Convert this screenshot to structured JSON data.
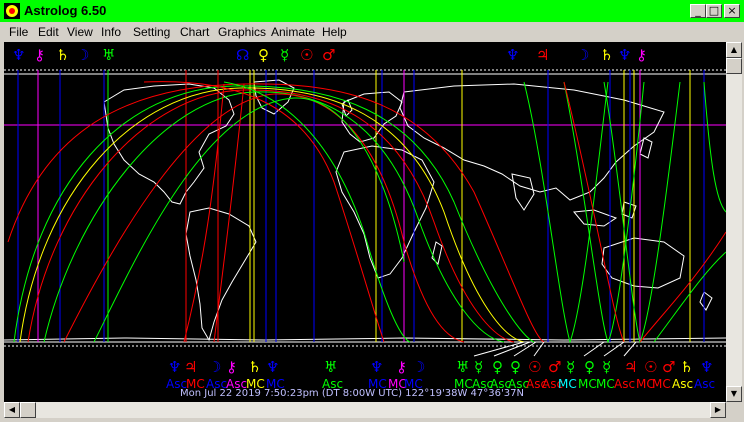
{
  "window": {
    "title": "Astrolog 6.50",
    "minimize": "_",
    "maximize": "□",
    "close": "×",
    "accent": "#00ff00"
  },
  "menu": [
    {
      "label": "File"
    },
    {
      "label": "Edit"
    },
    {
      "label": "View"
    },
    {
      "label": "Info"
    },
    {
      "label": "Setting"
    },
    {
      "label": "Chart"
    },
    {
      "label": "Graphics"
    },
    {
      "label": "Animate"
    },
    {
      "label": "Help"
    }
  ],
  "chart": {
    "status_text": "Mon Jul 22 2019  7:50:23pm (DT 8:00W UTC) 122°19'38W 47°36'37N",
    "top_glyphs": [
      {
        "glyph": "♆",
        "color": "#0000ff"
      },
      {
        "glyph": "⚷",
        "color": "#ff00ff"
      },
      {
        "glyph": "♄",
        "color": "#ffff00"
      },
      {
        "glyph": "☽",
        "color": "#0000ff"
      },
      {
        "glyph": "♅",
        "color": "#00ff00"
      },
      {
        "glyph": "☊",
        "color": "#0000ff"
      },
      {
        "glyph": "♀",
        "color": "#ffff00"
      },
      {
        "glyph": "☿",
        "color": "#00ff00"
      },
      {
        "glyph": "☉",
        "color": "#ff0000"
      },
      {
        "glyph": "♂",
        "color": "#ff0000"
      },
      {
        "glyph": "♆",
        "color": "#0000ff"
      },
      {
        "glyph": "♃",
        "color": "#ff0000"
      },
      {
        "glyph": "☽",
        "color": "#0000ff"
      },
      {
        "glyph": "♄",
        "color": "#ffff00"
      },
      {
        "glyph": "♆",
        "color": "#0000ff"
      },
      {
        "glyph": "⚷",
        "color": "#ff00ff"
      }
    ],
    "bottom_glyphs": [
      {
        "glyph": "♆",
        "color": "#0000ff"
      },
      {
        "glyph": "♃",
        "color": "#ff0000"
      },
      {
        "glyph": "☽",
        "color": "#0000ff"
      },
      {
        "glyph": "⚷",
        "color": "#ff00ff"
      },
      {
        "glyph": "♄",
        "color": "#ffff00"
      },
      {
        "glyph": "♆",
        "color": "#0000ff"
      },
      {
        "glyph": "♅",
        "color": "#00ff00"
      },
      {
        "glyph": "♆",
        "color": "#0000ff"
      },
      {
        "glyph": "⚷",
        "color": "#ff00ff"
      },
      {
        "glyph": "☽",
        "color": "#0000ff"
      },
      {
        "glyph": "♅",
        "color": "#00ff00"
      },
      {
        "glyph": "☿",
        "color": "#00ff00"
      },
      {
        "glyph": "♀",
        "color": "#00ff00"
      },
      {
        "glyph": "♀",
        "color": "#00ff00"
      },
      {
        "glyph": "☉",
        "color": "#ff0000"
      },
      {
        "glyph": "♂",
        "color": "#ff0000"
      },
      {
        "glyph": "☿",
        "color": "#00ff00"
      },
      {
        "glyph": "♀",
        "color": "#00ff00"
      },
      {
        "glyph": "☿",
        "color": "#00ff00"
      },
      {
        "glyph": "♃",
        "color": "#ff0000"
      },
      {
        "glyph": "☉",
        "color": "#ff0000"
      },
      {
        "glyph": "♂",
        "color": "#ff0000"
      },
      {
        "glyph": "♄",
        "color": "#ffff00"
      },
      {
        "glyph": "♆",
        "color": "#0000ff"
      }
    ],
    "bottom_labels": [
      {
        "text": "Asc",
        "color": "#0000ff"
      },
      {
        "text": "MC",
        "color": "#ff0000"
      },
      {
        "text": "Asc",
        "color": "#0000ff"
      },
      {
        "text": "Asc",
        "color": "#ff00ff"
      },
      {
        "text": "MC",
        "color": "#ffff00"
      },
      {
        "text": "MC",
        "color": "#0000ff"
      },
      {
        "text": "Asc",
        "color": "#00ff00"
      },
      {
        "text": "MC",
        "color": "#0000ff"
      },
      {
        "text": "MC",
        "color": "#ff00ff"
      },
      {
        "text": "MC",
        "color": "#0000ff"
      },
      {
        "text": "MC",
        "color": "#00ff00"
      },
      {
        "text": "Asc",
        "color": "#00ff00"
      },
      {
        "text": "Asc",
        "color": "#00ff00"
      },
      {
        "text": "Asc",
        "color": "#00ff00"
      },
      {
        "text": "Asc",
        "color": "#ff0000"
      },
      {
        "text": "Asc",
        "color": "#ff0000"
      },
      {
        "text": "MC",
        "color": "#00ffff"
      },
      {
        "text": "MC",
        "color": "#00ff00"
      },
      {
        "text": "MC",
        "color": "#00ff00"
      },
      {
        "text": "Asc",
        "color": "#ff0000"
      },
      {
        "text": "MC",
        "color": "#ff0000"
      },
      {
        "text": "MC",
        "color": "#ff0000"
      },
      {
        "text": "Asc",
        "color": "#ffff00"
      },
      {
        "text": "Asc",
        "color": "#0000ff"
      }
    ]
  }
}
